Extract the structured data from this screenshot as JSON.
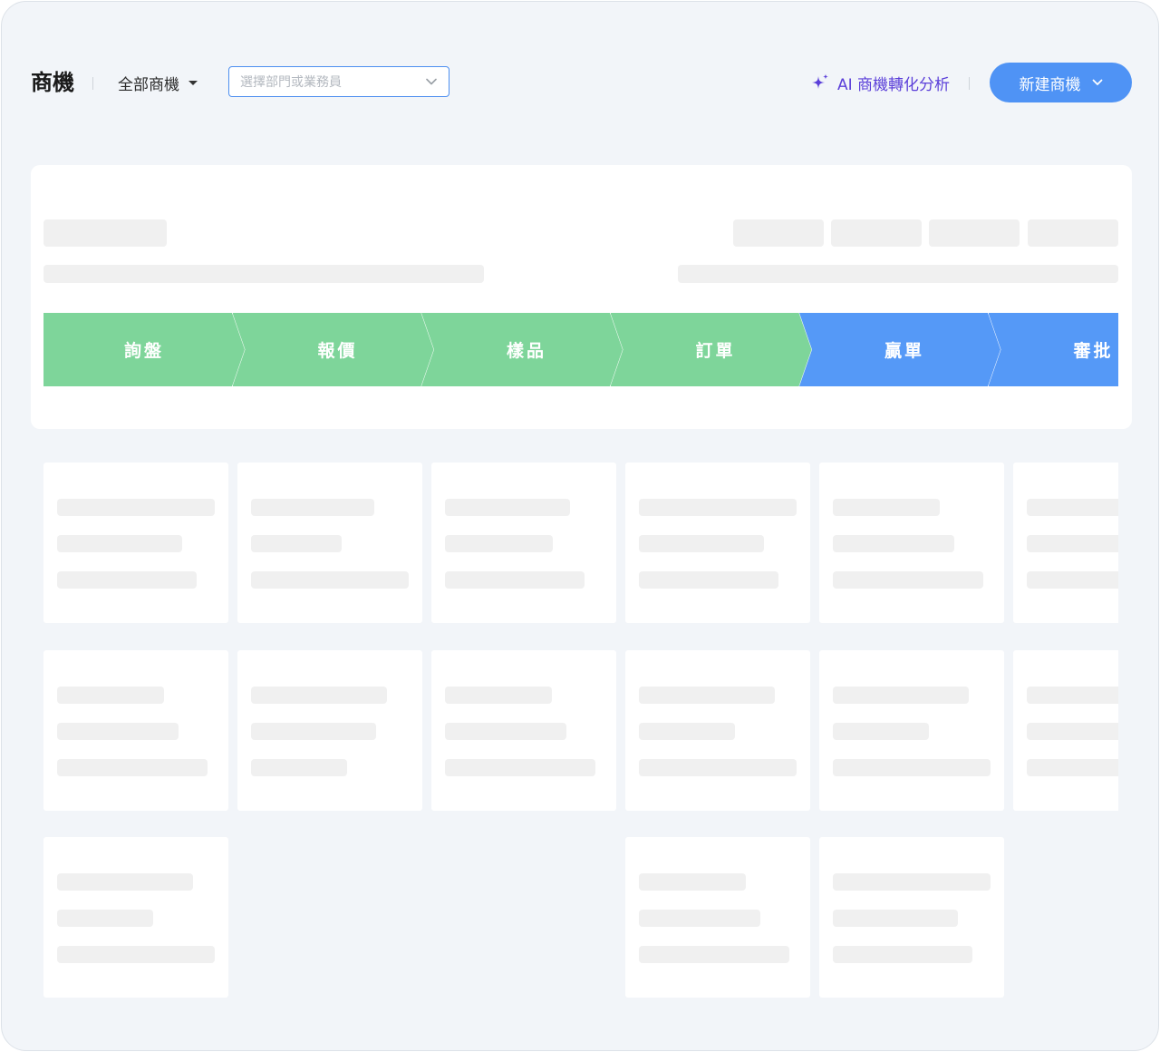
{
  "header": {
    "title": "商機",
    "scope_filter": "全部商機",
    "department_placeholder": "選擇部門或業務員",
    "ai_link_label": "AI 商機轉化分析",
    "new_button_label": "新建商機",
    "ai_color": "#5b3fd9"
  },
  "pipeline": {
    "stages": [
      {
        "label": "詢盤",
        "color": "#7ed59a"
      },
      {
        "label": "報價",
        "color": "#7ed59a"
      },
      {
        "label": "樣品",
        "color": "#7ed59a"
      },
      {
        "label": "訂單",
        "color": "#7ed59a"
      },
      {
        "label": "贏單",
        "color": "#5599f7"
      },
      {
        "label": "審批",
        "color": "#5599f7"
      }
    ]
  },
  "icons": {
    "scope_caret": "caret-down-icon",
    "department_chevron": "chevron-down-icon",
    "ai": "sparkle-icon",
    "new_chevron": "chevron-down-icon"
  },
  "colors": {
    "primary": "#4f93f5",
    "completed_stage": "#7ed59a",
    "upcoming_stage": "#5599f7",
    "skeleton": "#f0f0f0",
    "background": "#f2f5f9"
  }
}
